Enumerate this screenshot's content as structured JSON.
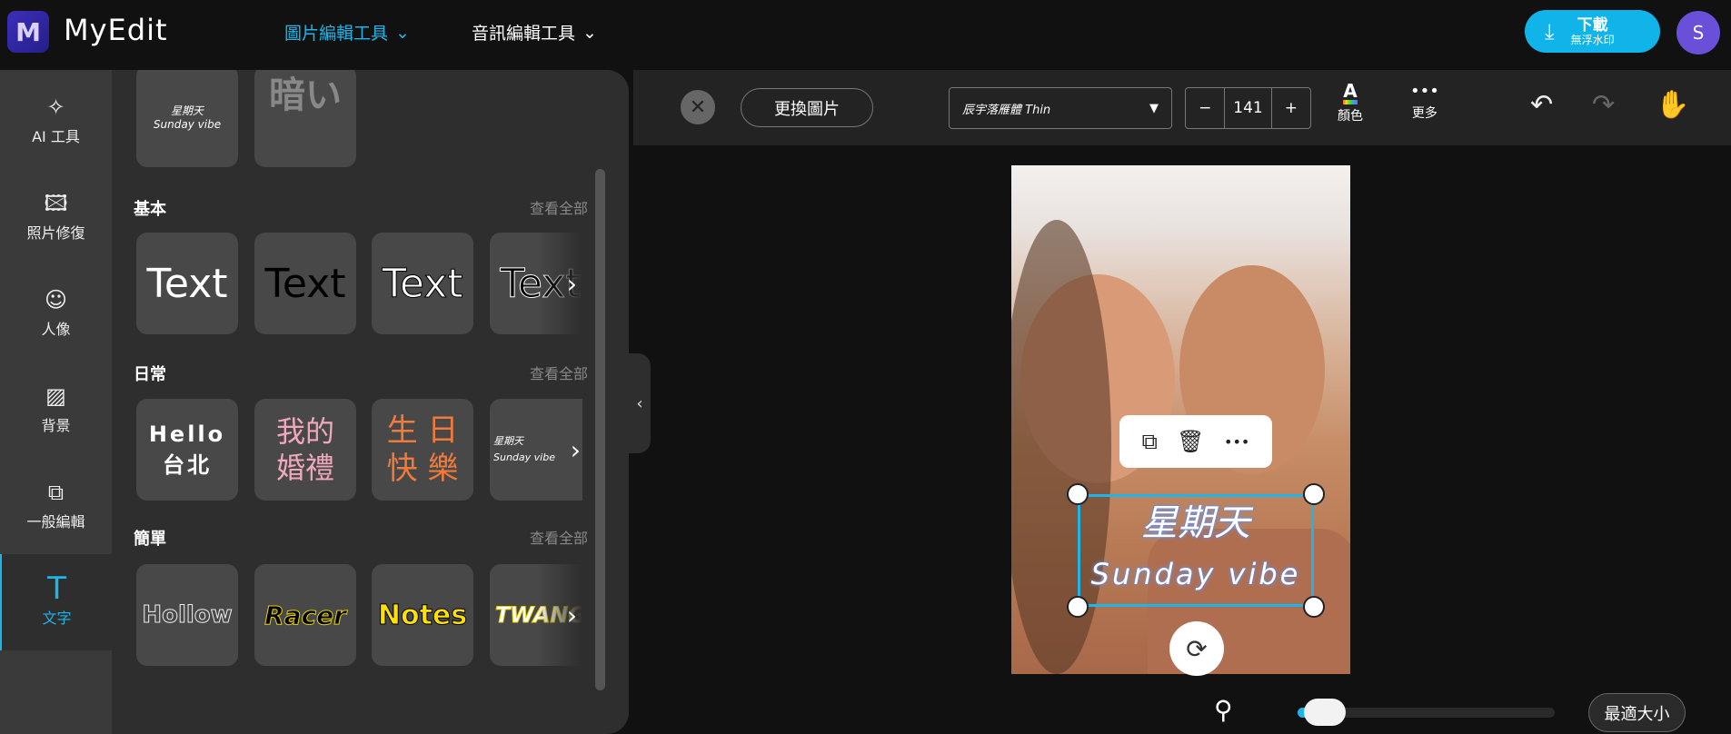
{
  "header": {
    "logo": "M",
    "brand": "MyEdit",
    "nav": [
      {
        "label": "圖片編輯工具",
        "active": true
      },
      {
        "label": "音訊編輯工具",
        "active": false
      }
    ],
    "download": {
      "label": "下載",
      "sublabel": "無浮水印"
    },
    "avatar": "S",
    "accent": "#1fb5e8"
  },
  "sidebar": {
    "items": [
      {
        "label": "AI 工具",
        "icon": "magic-wand-icon"
      },
      {
        "label": "照片修復",
        "icon": "photo-enhance-icon"
      },
      {
        "label": "人像",
        "icon": "portrait-icon"
      },
      {
        "label": "背景",
        "icon": "background-icon"
      },
      {
        "label": "一般編輯",
        "icon": "crop-icon"
      },
      {
        "label": "文字",
        "icon": "text-icon",
        "active": true
      }
    ]
  },
  "panel": {
    "top_cards": [
      "星期天\nSunday vibe",
      "暗い"
    ],
    "sections": [
      {
        "title": "基本",
        "see_all": "查看全部",
        "cards": [
          "Text",
          "Text",
          "Text",
          "Text"
        ]
      },
      {
        "title": "日常",
        "see_all": "查看全部",
        "cards": [
          "Hello\n台北",
          "我的\n婚禮",
          "生 日\n快 樂",
          "星期天\nSunday vibe"
        ]
      },
      {
        "title": "簡單",
        "see_all": "查看全部",
        "cards": [
          "Hollow",
          "Racer",
          "Notes",
          "TWANG"
        ]
      }
    ]
  },
  "toolbar": {
    "replace_image": "更換圖片",
    "font": "辰宇落雁體 Thin",
    "font_size": "141",
    "minus": "−",
    "plus": "+",
    "color_label": "顏色",
    "more_label": "更多"
  },
  "canvas": {
    "text_line1": "星期天",
    "text_line2": "Sunday vibe"
  },
  "zoom": {
    "level_percent": 2,
    "fit_label": "最適大小"
  }
}
